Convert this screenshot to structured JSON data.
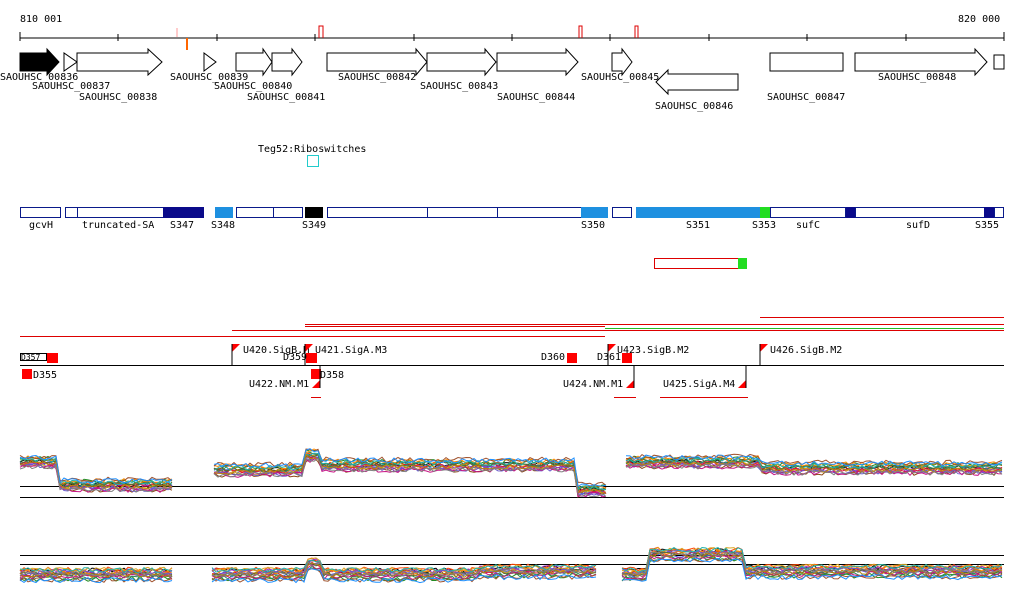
{
  "ruler": {
    "start_label": "810 001",
    "end_label": "820 000"
  },
  "genes": [
    {
      "label": "SAOUHSC_00836"
    },
    {
      "label": "SAOUHSC_00837"
    },
    {
      "label": "SAOUHSC_00838"
    },
    {
      "label": "SAOUHSC_00839"
    },
    {
      "label": "SAOUHSC_00840"
    },
    {
      "label": "SAOUHSC_00841"
    },
    {
      "label": "SAOUHSC_00842"
    },
    {
      "label": "SAOUHSC_00843"
    },
    {
      "label": "SAOUHSC_00844"
    },
    {
      "label": "SAOUHSC_00845"
    },
    {
      "label": "SAOUHSC_00846"
    },
    {
      "label": "SAOUHSC_00847"
    },
    {
      "label": "SAOUHSC_00848"
    }
  ],
  "riboswitch": {
    "label": "Teg52:Riboswitches"
  },
  "segments": {
    "labels": [
      "gcvH",
      "truncated-SA",
      "S347",
      "S348",
      "S349",
      "S350",
      "S351",
      "S353",
      "sufC",
      "sufD",
      "S355"
    ],
    "colors": {
      "outline": "#0a1a8a",
      "dark": "#0a0a8a",
      "light": "#1e90e0",
      "black": "#000000",
      "green": "#22dd22"
    }
  },
  "promoters": {
    "upper": [
      "U420.SigB.M",
      "U421.SigA.M3",
      "D359",
      "D360",
      "D361",
      "U423.SigB.M2",
      "U426.SigB.M2",
      "D357"
    ],
    "lower": [
      "D355",
      "U422.NM.M1",
      "D358",
      "U424.NM.M1",
      "U425.SigA.M4"
    ]
  },
  "colors": {
    "feature_red": "#ff0000",
    "line_green": "#22bb22",
    "line_red": "#dd0000"
  }
}
